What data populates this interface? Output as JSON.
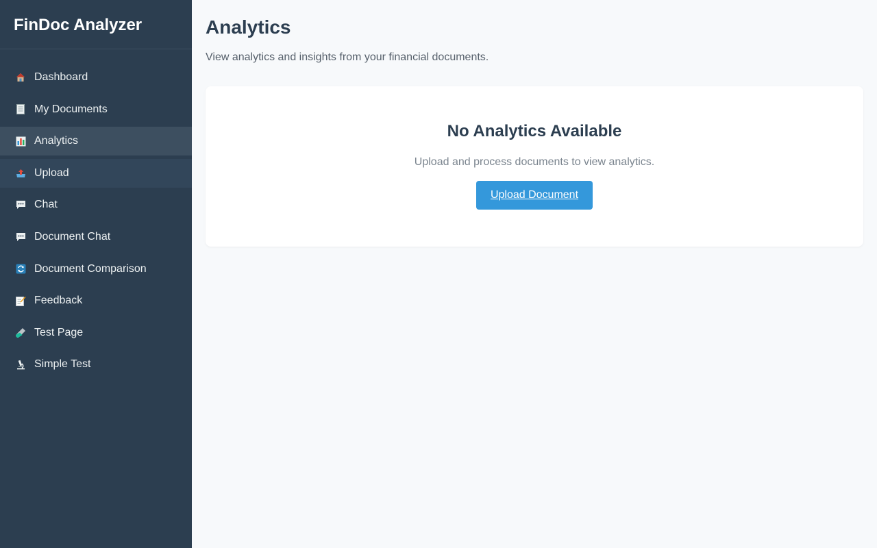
{
  "app": {
    "title": "FinDoc Analyzer"
  },
  "sidebar": {
    "items": [
      {
        "label": "Dashboard",
        "icon": "home-icon"
      },
      {
        "label": "My Documents",
        "icon": "document-icon"
      },
      {
        "label": "Analytics",
        "icon": "bar-chart-icon",
        "active": true
      },
      {
        "label": "Upload",
        "icon": "upload-icon"
      },
      {
        "label": "Chat",
        "icon": "chat-icon"
      },
      {
        "label": "Document Chat",
        "icon": "chat-icon"
      },
      {
        "label": "Document Comparison",
        "icon": "refresh-icon"
      },
      {
        "label": "Feedback",
        "icon": "memo-icon"
      },
      {
        "label": "Test Page",
        "icon": "test-tube-icon"
      },
      {
        "label": "Simple Test",
        "icon": "microscope-icon"
      }
    ]
  },
  "main": {
    "title": "Analytics",
    "subtitle": "View analytics and insights from your financial documents.",
    "empty_state": {
      "title": "No Analytics Available",
      "message": "Upload and process documents to view analytics.",
      "button_label": "Upload Document"
    }
  },
  "colors": {
    "sidebar_bg": "#2c3e50",
    "accent": "#3498db",
    "page_bg": "#f7f9fb"
  }
}
